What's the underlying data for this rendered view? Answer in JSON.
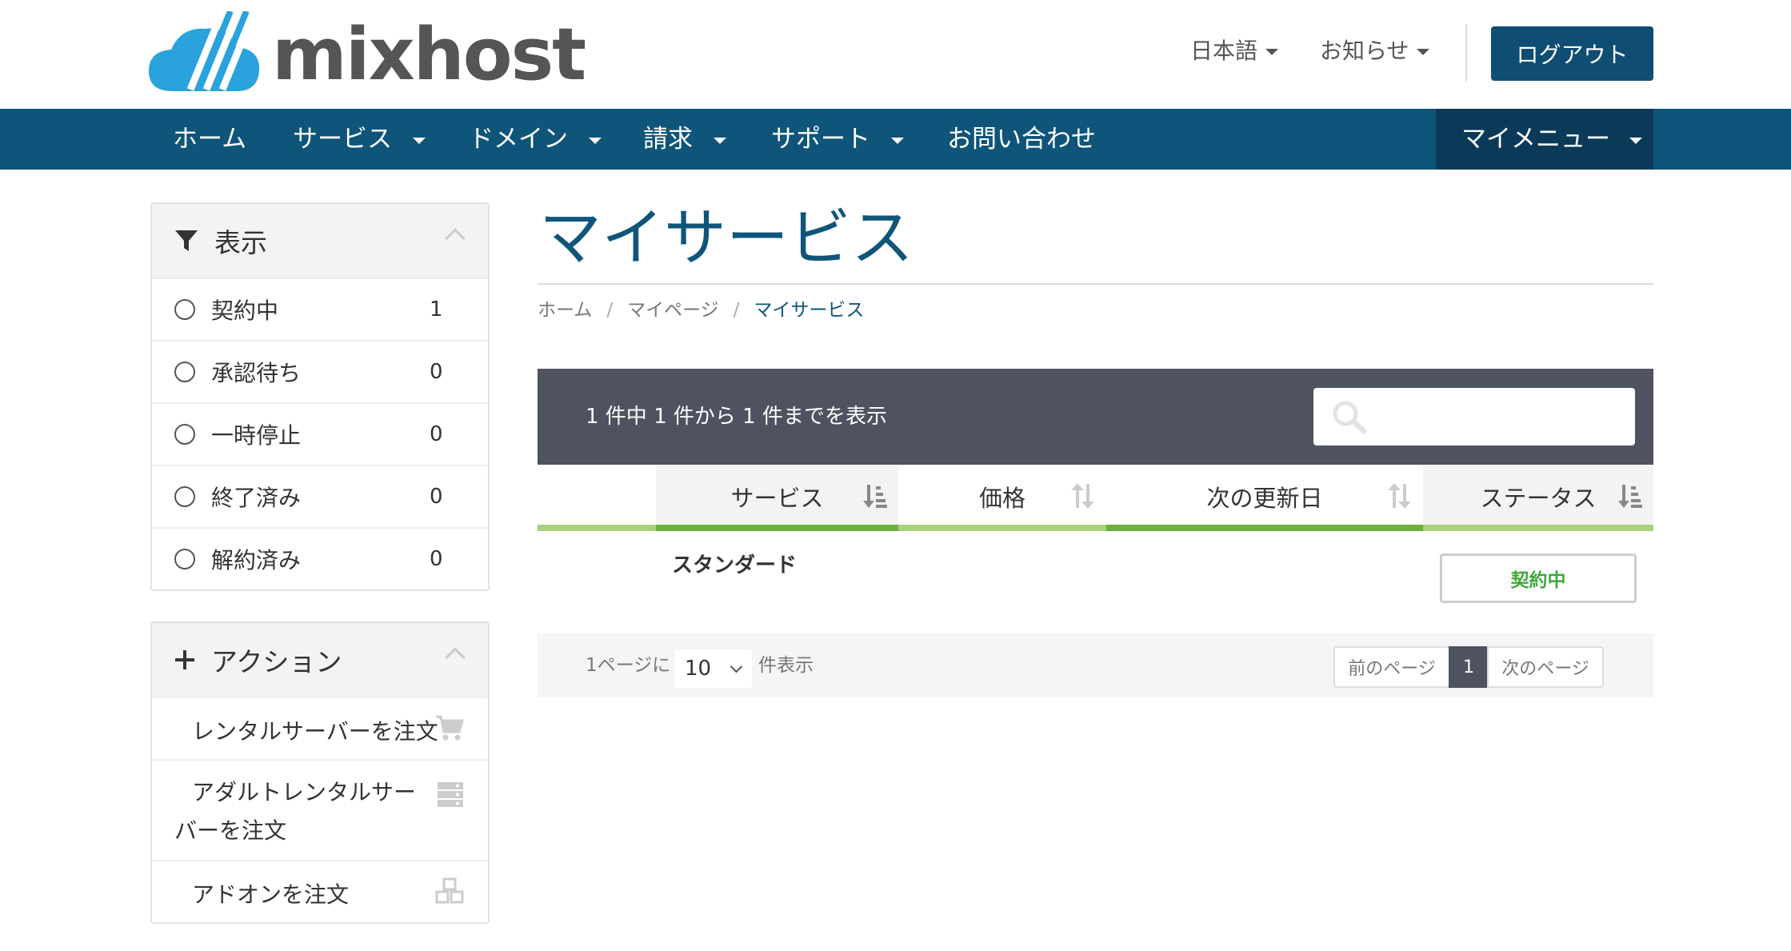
{
  "brand": {
    "name": "mixhost"
  },
  "top_menu": {
    "language": "日本語",
    "notices": "お知らせ",
    "logout": "ログアウト"
  },
  "nav": {
    "items": [
      "ホーム",
      "サービス",
      "ドメイン",
      "請求",
      "サポート",
      "お問い合わせ"
    ],
    "my_menu": "マイメニュー"
  },
  "sidebar": {
    "view_panel": {
      "title": "表示",
      "filters": [
        {
          "label": "契約中",
          "count": "1"
        },
        {
          "label": "承認待ち",
          "count": "0"
        },
        {
          "label": "一時停止",
          "count": "0"
        },
        {
          "label": "終了済み",
          "count": "0"
        },
        {
          "label": "解約済み",
          "count": "0"
        }
      ]
    },
    "action_panel": {
      "title": "アクション",
      "items": [
        {
          "label": "レンタルサーバーを注文",
          "icon": "cart-icon"
        },
        {
          "label": "アダルトレンタルサーバーを注文",
          "icon": "server-icon"
        },
        {
          "label": "アドオンを注文",
          "icon": "cubes-icon"
        }
      ]
    }
  },
  "main": {
    "title": "マイサービス",
    "breadcrumb": [
      "ホーム",
      "マイページ",
      "マイサービス"
    ],
    "table": {
      "info": "1 件中 1 件から 1 件までを表示",
      "search_placeholder": "",
      "columns": [
        "サービス",
        "価格",
        "次の更新日",
        "ステータス"
      ],
      "rows": [
        {
          "service": "スタンダード",
          "price": "",
          "next_renewal": "",
          "status": "契約中"
        }
      ],
      "footer": {
        "per_page_prefix": "1ページに",
        "per_page_value": "10",
        "per_page_suffix": "件表示",
        "prev": "前のページ",
        "current_page": "1",
        "next": "次のページ"
      }
    }
  },
  "colors": {
    "brand_blue": "#0f557a",
    "dark_nav": "#0a3a58",
    "table_header": "#4f5260",
    "active_green": "#3ea83a",
    "sort_bar": "#9ccc6a"
  }
}
